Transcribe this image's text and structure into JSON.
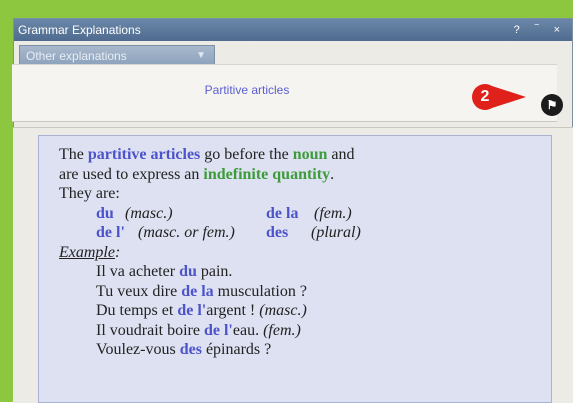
{
  "window": {
    "title": "Grammar Explanations",
    "controls": "? ‾ ×"
  },
  "toolbar": {
    "dropdown_label": "Other explanations",
    "dropdown_icon": "chevron-down-icon"
  },
  "header": {
    "section_title": "Partitive articles",
    "callout_number": "2",
    "flag_icon": "flag-icon"
  },
  "content": {
    "intro": {
      "t1": "The ",
      "k1": "partitive articles",
      "t2": " go before the ",
      "k2": "noun",
      "t3": " and",
      "t4": "are used to express an ",
      "k3": "indefinite quantity",
      "t5": ".",
      "t6": "They are:"
    },
    "articles": [
      {
        "article": "du",
        "note": "(masc.)"
      },
      {
        "article": "de la",
        "note": "(fem.)"
      },
      {
        "article": "de l'",
        "note": "(masc. or fem.)"
      },
      {
        "article": "des",
        "note": "(plural)"
      }
    ],
    "example_label": "Example",
    "example_colon": ":",
    "examples": [
      {
        "pre": "Il va acheter ",
        "art": "du",
        "post": " pain.",
        "note": ""
      },
      {
        "pre": "Tu veux dire ",
        "art": "de la",
        "post": " musculation ?",
        "note": ""
      },
      {
        "pre": "Du temps et ",
        "art": "de l'",
        "post": "argent ! ",
        "note": "(masc.)"
      },
      {
        "pre": "Il voudrait boire ",
        "art": "de l'",
        "post": "eau. ",
        "note": "(fem.)"
      },
      {
        "pre": "Voulez-vous ",
        "art": "des",
        "post": " épinards ?",
        "note": ""
      }
    ]
  },
  "colors": {
    "accent_blue": "#4d53c9",
    "accent_green": "#3d9b3a",
    "callout_red": "#e0201a",
    "frame_green": "#8dc63f"
  }
}
